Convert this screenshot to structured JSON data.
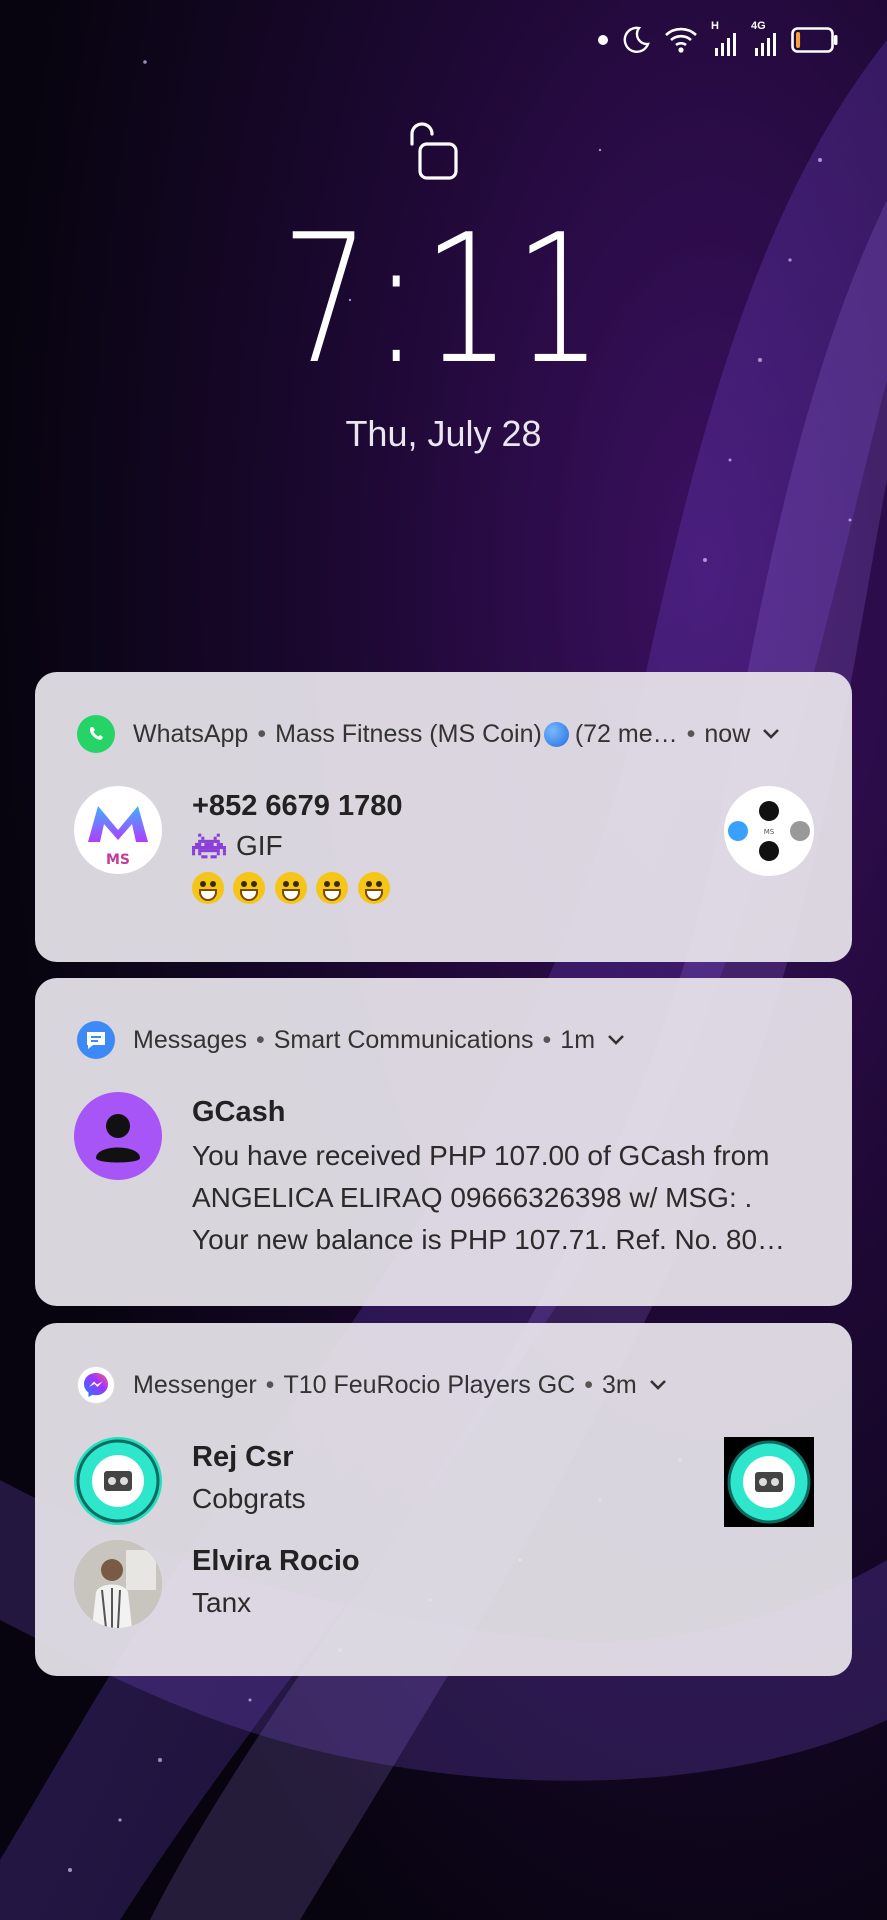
{
  "status_bar": {
    "icons": [
      "dot-icon",
      "moon-icon",
      "wifi-icon",
      "signal-h-icon",
      "signal-4g-icon",
      "battery-icon"
    ],
    "network_labels": [
      "H",
      "4G"
    ],
    "battery_level": 0.12
  },
  "lock": {
    "icon": "unlocked-padlock-icon",
    "time": "7:11",
    "date": "Thu,  July 28"
  },
  "notifications": [
    {
      "app": "WhatsApp",
      "conversation": "Mass Fitness (MS Coin)",
      "count_text": "(72 me…",
      "time": "now",
      "sender": "+852 6679 1780",
      "gif_label": "GIF",
      "emoji_count": 5,
      "accent": "#25D366"
    },
    {
      "app": "Messages",
      "conversation": "Smart Communications",
      "time": "1m",
      "sender": "GCash",
      "lines": [
        "You have received PHP 107.00 of GCash from",
        "ANGELICA ELIRAQ 09666326398 w/ MSG: .",
        "Your new balance is PHP 107.71. Ref. No. 80…"
      ],
      "accent": "#3d8af7",
      "avatar_color": "#a855f7"
    },
    {
      "app": "Messenger",
      "conversation": "T10 FeuRocio Players GC",
      "time": "3m",
      "messages": [
        {
          "sender": "Rej Csr",
          "text": "Cobgrats"
        },
        {
          "sender": "Elvira Rocio",
          "text": "Tanx"
        }
      ],
      "accent": "#7b3fe4"
    }
  ]
}
